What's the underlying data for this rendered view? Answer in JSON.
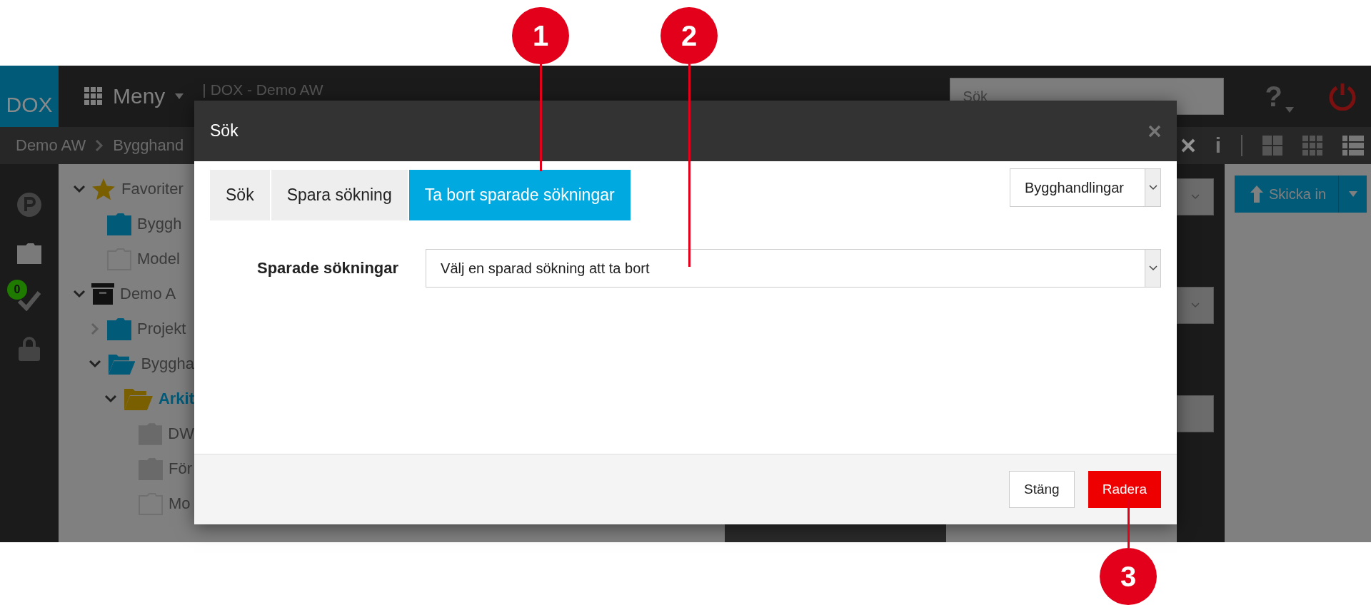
{
  "callouts": [
    {
      "number": "1"
    },
    {
      "number": "2"
    },
    {
      "number": "3"
    }
  ],
  "topbar": {
    "logo": "DOX",
    "menu": "Meny",
    "title": "| DOX - Demo AW",
    "search": {
      "placeholder": "Sök"
    },
    "help": "?"
  },
  "breadcrumb": [
    "Demo AW",
    "Bygghand"
  ],
  "rail": {
    "badge": "0"
  },
  "tree": [
    {
      "label": "Favoriter",
      "kind": "star",
      "expanded": true,
      "children": [
        {
          "label": "Byggh",
          "kind": "folder"
        },
        {
          "label": "Model",
          "kind": "empty-folder"
        }
      ]
    },
    {
      "label": "Demo A",
      "kind": "archive",
      "expanded": true,
      "children": [
        {
          "label": "Projekt",
          "kind": "folder",
          "expanded": false
        },
        {
          "label": "Byggha",
          "kind": "open-folder",
          "expanded": true,
          "children": [
            {
              "label": "Arkit",
              "kind": "yellow-open-folder",
              "selected": true,
              "expanded": true,
              "children": [
                {
                  "label": "DW",
                  "kind": "grey-folder"
                },
                {
                  "label": "För",
                  "kind": "grey-folder"
                },
                {
                  "label": "Mo",
                  "kind": "empty-folder"
                }
              ]
            }
          ]
        }
      ]
    }
  ],
  "side_panel": {
    "info": "i"
  },
  "main": {
    "upload_button": "Skicka in"
  },
  "dialog": {
    "title": "Sök",
    "tabs": [
      {
        "label": "Sök",
        "selected": false
      },
      {
        "label": "Spara sökning",
        "selected": false
      },
      {
        "label": "Ta bort sparade sökningar",
        "selected": true
      }
    ],
    "scope_select": {
      "value": "Bygghandlingar"
    },
    "field": {
      "label": "Sparade sökningar",
      "placeholder": "Välj en sparad sökning att ta bort"
    },
    "buttons": [
      {
        "label": "Stäng",
        "kind": "secondary"
      },
      {
        "label": "Radera",
        "kind": "danger"
      }
    ]
  }
}
